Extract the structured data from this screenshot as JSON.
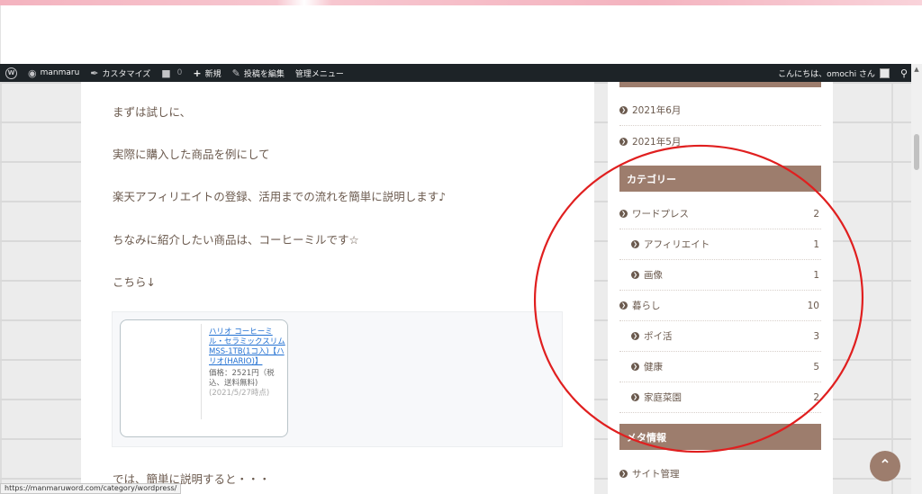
{
  "admin_bar": {
    "site_name": "manmaru",
    "customize": "カスタマイズ",
    "comments_count": "0",
    "new": "新規",
    "edit_post": "投稿を編集",
    "admin_menu": "管理メニュー",
    "greeting": "こんにちは、omochi さん"
  },
  "article": {
    "paragraphs": [
      "まずは試しに、",
      "実際に購入した商品を例にして",
      "楽天アフィリエイトの登録、活用までの流れを簡単に説明します♪",
      "ちなみに紹介したい商品は、コーヒーミルです☆",
      "こちら↓"
    ],
    "product": {
      "title": "ハリオ コーヒーミル・セラミックスリム MSS-1TB(1コ入)【ハリオ(HARIO)】",
      "price": "価格：2521円（税込、送料無料)",
      "date": "(2021/5/27時点)"
    },
    "trailing_text": "では、簡単に説明すると・・・"
  },
  "sidebar": {
    "archives": [
      "2021年6月",
      "2021年5月"
    ],
    "category_title": "カテゴリー",
    "categories": [
      {
        "label": "ワードプレス",
        "count": "2",
        "sub": false
      },
      {
        "label": "アフィリエイト",
        "count": "1",
        "sub": true
      },
      {
        "label": "画像",
        "count": "1",
        "sub": true
      },
      {
        "label": "暮らし",
        "count": "10",
        "sub": false
      },
      {
        "label": "ポイ活",
        "count": "3",
        "sub": true
      },
      {
        "label": "健康",
        "count": "5",
        "sub": true
      },
      {
        "label": "家庭菜園",
        "count": "2",
        "sub": true
      }
    ],
    "meta_title": "メタ情報",
    "meta_items": [
      "サイト管理"
    ]
  },
  "status_url": "https://manmaruword.com/category/wordpress/",
  "colors": {
    "accent": "#9d7d6d",
    "text": "#6b5a4e",
    "admin_bar": "#1d2327",
    "link": "#1f6fd2",
    "annotation": "#e01f1f"
  }
}
